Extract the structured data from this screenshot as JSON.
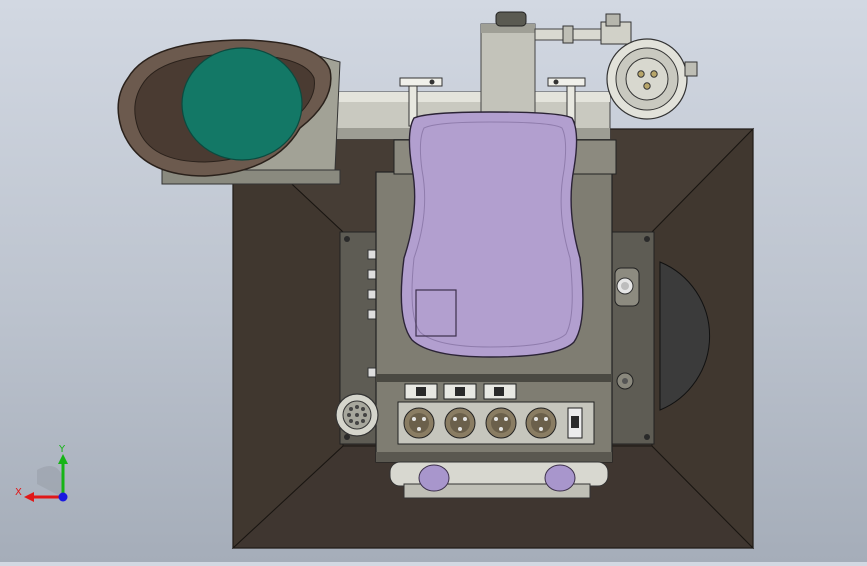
{
  "viewport": {
    "view": "top",
    "model": "camcorder-assembly",
    "colors": {
      "background_top": "#d2d8e2",
      "background_bottom": "#a5adb9",
      "hood_outer": "#3a322c",
      "hood_face": "#473e37",
      "body_gray": "#7d7b70",
      "body_light": "#c8c7bd",
      "panel_purple": "#b29fcf",
      "lens_teal": "#137866",
      "lens_shroud": "#6c5a4e",
      "knob_purple": "#a896cc"
    },
    "switches": [
      {
        "name": "switch-1",
        "position": "left"
      },
      {
        "name": "switch-2",
        "position": "left"
      },
      {
        "name": "switch-3",
        "position": "right"
      }
    ],
    "xlr_connector_count": 4
  },
  "triad": {
    "x_label": "X",
    "y_label": "Y",
    "x_color": "#e01818",
    "y_color": "#16b416",
    "z_color": "#1a1ae0"
  }
}
